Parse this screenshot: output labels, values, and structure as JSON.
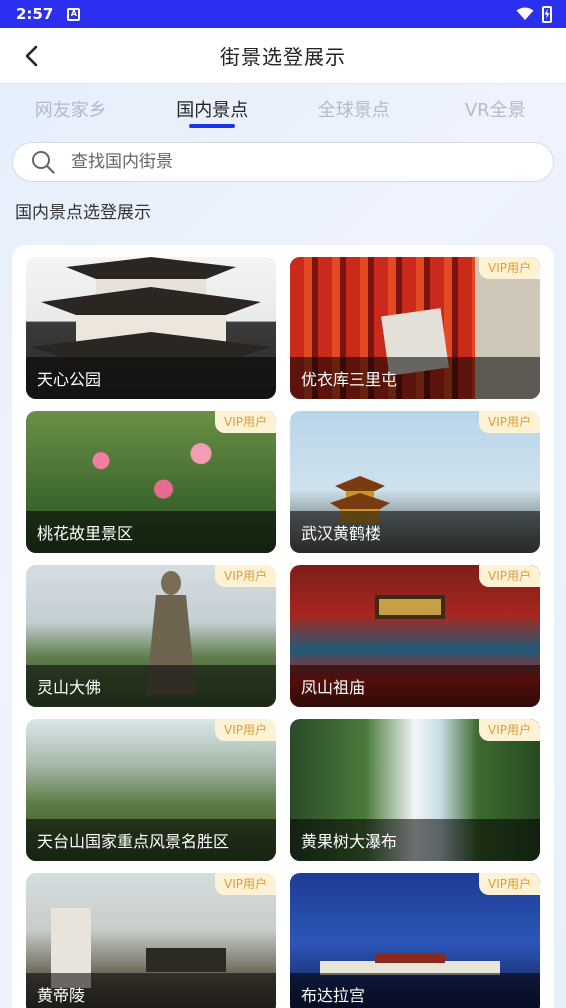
{
  "status_bar": {
    "time": "2:57",
    "notif_letter": "A"
  },
  "header": {
    "title": "街景选登展示"
  },
  "tabs": [
    {
      "label": "网友家乡",
      "active": false
    },
    {
      "label": "国内景点",
      "active": true
    },
    {
      "label": "全球景点",
      "active": false
    },
    {
      "label": "VR全景",
      "active": false
    }
  ],
  "search": {
    "placeholder": "查找国内街景",
    "value": ""
  },
  "section_title": "国内景点选登展示",
  "spots": [
    {
      "name": "天心公园",
      "vip": false,
      "vip_label": ""
    },
    {
      "name": "优衣库三里屯",
      "vip": true,
      "vip_label": "VIP用户"
    },
    {
      "name": "桃花故里景区",
      "vip": true,
      "vip_label": "VIP用户"
    },
    {
      "name": "武汉黄鹤楼",
      "vip": true,
      "vip_label": "VIP用户"
    },
    {
      "name": "灵山大佛",
      "vip": true,
      "vip_label": "VIP用户"
    },
    {
      "name": "凤山祖庙",
      "vip": true,
      "vip_label": "VIP用户"
    },
    {
      "name": "天台山国家重点风景名胜区",
      "vip": true,
      "vip_label": "VIP用户"
    },
    {
      "name": "黄果树大瀑布",
      "vip": true,
      "vip_label": "VIP用户"
    },
    {
      "name": "黄帝陵",
      "vip": true,
      "vip_label": "VIP用户"
    },
    {
      "name": "布达拉宫",
      "vip": true,
      "vip_label": "VIP用户"
    }
  ],
  "colors": {
    "status_bar": "#2b2ff0",
    "tab_indicator": "#1b35e6",
    "vip_text": "#e39c2a",
    "vip_bg": "#fdf2d6"
  },
  "icons": {
    "back": "chevron-left-icon",
    "search": "search-icon",
    "wifi": "wifi-icon",
    "battery": "battery-icon"
  }
}
